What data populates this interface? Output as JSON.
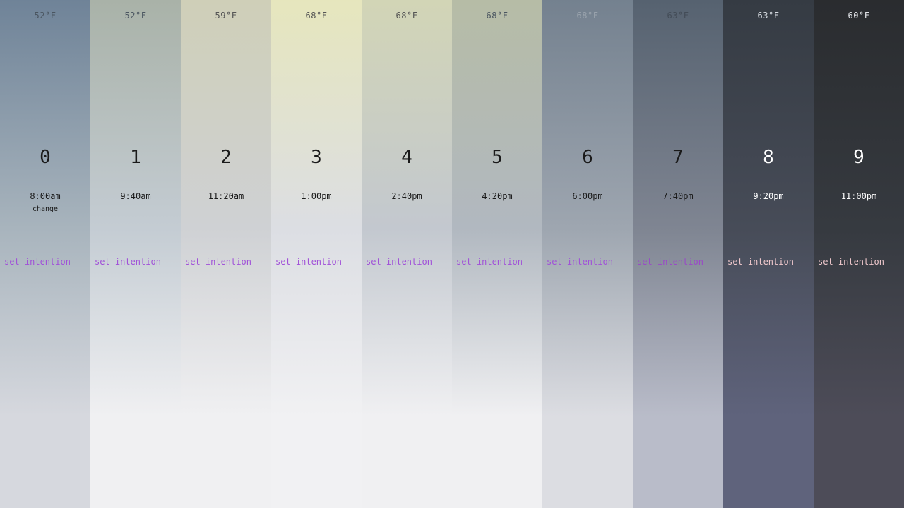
{
  "columns": [
    {
      "index": "0",
      "temp": "52°F",
      "time": "8:00am",
      "change_label": "change",
      "intention_label": "set intention",
      "colors": {
        "top": "#6f8398",
        "mid": "#a8b4bd",
        "bottom": "#d6d8de",
        "text": "#1a1a1a",
        "temp": "#4a5560",
        "intention": "#a050d8"
      }
    },
    {
      "index": "1",
      "temp": "52°F",
      "time": "9:40am",
      "intention_label": "set intention",
      "colors": {
        "top": "#a9b2a8",
        "mid": "#c4ccd3",
        "bottom": "#f0f0f2",
        "text": "#1a1a1a",
        "temp": "#4a5560",
        "intention": "#a050d8"
      }
    },
    {
      "index": "2",
      "temp": "59°F",
      "time": "11:20am",
      "intention_label": "set intention",
      "colors": {
        "top": "#cfcfb8",
        "mid": "#cfd1d4",
        "bottom": "#f0f0f2",
        "text": "#1a1a1a",
        "temp": "#555555",
        "intention": "#a050d8"
      }
    },
    {
      "index": "3",
      "temp": "68°F",
      "time": "1:00pm",
      "intention_label": "set intention",
      "colors": {
        "top": "#e6e6bd",
        "mid": "#dcdee3",
        "bottom": "#f1f1f3",
        "text": "#1a1a1a",
        "temp": "#555555",
        "intention": "#a050d8"
      }
    },
    {
      "index": "4",
      "temp": "68°F",
      "time": "2:40pm",
      "intention_label": "set intention",
      "colors": {
        "top": "#d2d5b6",
        "mid": "#c3c8cf",
        "bottom": "#f0f0f2",
        "text": "#1a1a1a",
        "temp": "#555555",
        "intention": "#a050d8"
      }
    },
    {
      "index": "5",
      "temp": "68°F",
      "time": "4:20pm",
      "intention_label": "set intention",
      "colors": {
        "top": "#b6bca6",
        "mid": "#b1b8c0",
        "bottom": "#f0f0f2",
        "text": "#1a1a1a",
        "temp": "#4a5560",
        "intention": "#a050d8"
      }
    },
    {
      "index": "6",
      "temp": "68°F",
      "time": "6:00pm",
      "intention_label": "set intention",
      "colors": {
        "top": "#74818f",
        "mid": "#9ea6b0",
        "bottom": "#dcdde2",
        "text": "#1a1a1a",
        "temp": "#9aa3ad",
        "intention": "#a050d8"
      }
    },
    {
      "index": "7",
      "temp": "63°F",
      "time": "7:40pm",
      "intention_label": "set intention",
      "colors": {
        "top": "#566270",
        "mid": "#7f8592",
        "bottom": "#b9bcc9",
        "text": "#1a1a1a",
        "temp": "#434c57",
        "intention": "#9a48c8"
      }
    },
    {
      "index": "8",
      "temp": "63°F",
      "time": "9:20pm",
      "intention_label": "set intention",
      "colors": {
        "top": "#353b43",
        "mid": "#474c58",
        "bottom": "#5f637c",
        "text": "#ffffff",
        "temp": "#d8dde3",
        "intention": "#efc8cc"
      }
    },
    {
      "index": "9",
      "temp": "60°F",
      "time": "11:00pm",
      "intention_label": "set intention",
      "colors": {
        "top": "#2a2c2f",
        "mid": "#363a40",
        "bottom": "#4d4c58",
        "text": "#ffffff",
        "temp": "#e2e4e8",
        "intention": "#efc8cc"
      }
    }
  ]
}
